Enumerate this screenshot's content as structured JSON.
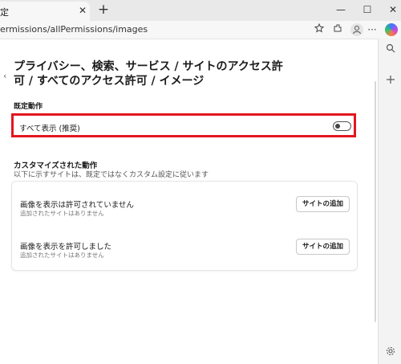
{
  "browser": {
    "tab_title": "定",
    "tab_close": "✕",
    "new_tab": "+",
    "window_minimize": "—",
    "window_maximize": "☐",
    "window_close": "✕",
    "address": "ermissions/allPermissions/images",
    "toolbar_icons": [
      "favorite-star-icon",
      "extensions-icon",
      "favorites-collection-icon",
      "profile-icon",
      "more-icon",
      "copilot-icon"
    ],
    "more_label": "···"
  },
  "sidebar": {
    "icons": [
      "search-icon",
      "add-icon",
      "settings-icon"
    ]
  },
  "page": {
    "back_chevron": "‹",
    "title": "プライバシー、検索、サービス / サイトのアクセス許可 / すべてのアクセス許可 / イメージ",
    "default_section_label": "既定動作",
    "default_option_label": "すべて表示 (推奨)",
    "default_option_enabled": false,
    "custom_section_title": "カスタマイズされた動作",
    "custom_section_subtitle": "以下に示すサイトは、既定ではなくカスタム設定に従います",
    "blocked": {
      "title": "画像を表示は許可されていません",
      "subtitle": "追加されたサイトはありません",
      "button": "サイトの追加"
    },
    "allowed": {
      "title": "画像を表示を許可しました",
      "subtitle": "追加されたサイトはありません",
      "button": "サイトの追加"
    }
  },
  "colors": {
    "highlight_border": "#e4161f",
    "page_background": "#ffffff",
    "chrome_background": "#f3f3f3"
  }
}
